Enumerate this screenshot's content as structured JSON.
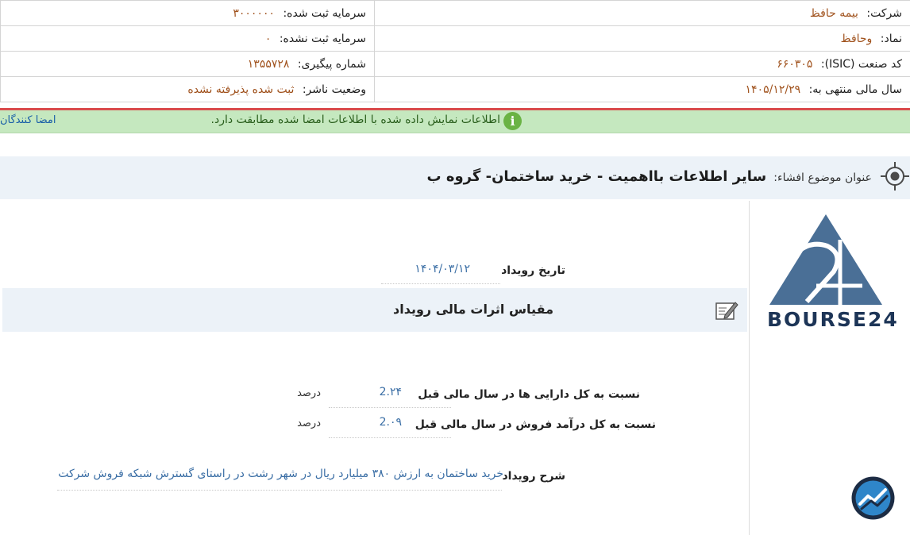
{
  "header": {
    "rows": [
      {
        "right_label": "شرکت:",
        "right_value": "بیمه حافظ",
        "left_label": "سرمایه ثبت شده:",
        "left_value": "۳۰۰۰۰۰۰"
      },
      {
        "right_label": "نماد:",
        "right_value": "وحافظ",
        "left_label": "سرمایه ثبت نشده:",
        "left_value": "۰"
      },
      {
        "right_label": "کد صنعت (ISIC):",
        "right_value": "۶۶۰۳۰۵",
        "left_label": "شماره پیگیری:",
        "left_value": "۱۳۵۵۷۲۸"
      },
      {
        "right_label": "سال مالی منتهی به:",
        "right_value": "۱۴۰۵/۱۲/۲۹",
        "left_label": "وضعیت ناشر:",
        "left_value": "ثبت شده پذیرفته نشده"
      }
    ]
  },
  "verify": {
    "message": "اطلاعات نمایش داده شده با اطلاعات امضا شده مطابقت دارد.",
    "info_icon_glyph": "i",
    "signers_link": "امضا کنندگان"
  },
  "subject": {
    "label": "عنوان موضوع افشاء:",
    "title": "سایر اطلاعات بااهمیت - خرید ساختمان- گروه ب"
  },
  "event": {
    "date_label": "تاریخ رویداد",
    "date_value": "۱۴۰۴/۰۳/۱۲"
  },
  "section": {
    "title": "مقیاس اثرات مالی رویداد"
  },
  "metrics": [
    {
      "label": "نسبت به کل دارایی ها در سال مالی قبل",
      "value": "2.۲۴",
      "unit": "درصد"
    },
    {
      "label": "نسبت به کل درآمد فروش در سال مالی قبل",
      "value": "2.۰۹",
      "unit": "درصد"
    }
  ],
  "description": {
    "label": "شرح رویداد",
    "value": "خرید ساختمان به ارزش ۳۸۰ میلیارد ریال در شهر رشت در راستای گسترش شبکه فروش شرکت"
  },
  "logo": {
    "text": "BOURSE24",
    "color": "#4a6f96"
  },
  "colors": {
    "value_brown": "#a0521d",
    "value_blue": "#3a6ea5",
    "verify_green_bg": "#c5e8bf",
    "alert_red": "#d94b4b"
  }
}
